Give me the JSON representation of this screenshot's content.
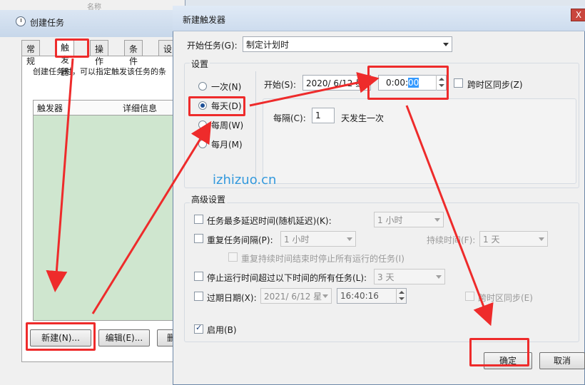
{
  "background_window": {
    "title": "创建任务",
    "top_text": "名称",
    "tabs": [
      "常规",
      "触发器",
      "操作",
      "条件",
      "设"
    ],
    "active_tab": "触发器",
    "description": "创建任务时，可以指定触发该任务的条",
    "columns": [
      "触发器",
      "详细信息"
    ],
    "buttons": {
      "new": "新建(N)...",
      "edit": "编辑(E)...",
      "delete": "删"
    }
  },
  "dialog": {
    "title": "新建触发器",
    "close_label": "X",
    "begin_task_label": "开始任务(G):",
    "begin_task_value": "制定计划时",
    "settings_label": "设置",
    "frequency": [
      "一次(N)",
      "每天(D)",
      "每周(W)",
      "每月(M)"
    ],
    "selected_frequency": "每天(D)",
    "start_label": "开始(S):",
    "start_date": "2020/ 6/12 星",
    "start_time_prefix": "0:00:",
    "start_time_selected": "00",
    "sync_tz": "跨时区同步(Z)",
    "interval_label": "每隔(C):",
    "interval_value": "1",
    "interval_suffix": "天发生一次",
    "advanced_label": "高级设置",
    "delay_label": "任务最多延迟时间(随机延迟)(K):",
    "delay_value": "1 小时",
    "repeat_label": "重复任务间隔(P):",
    "repeat_value": "1 小时",
    "duration_label": "持续时间(F):",
    "duration_value": "1 天",
    "stop_all_label": "重复持续时间结束时停止所有运行的任务(I)",
    "stop_over_label": "停止运行时间超过以下时间的所有任务(L):",
    "stop_over_value": "3 天",
    "expire_label": "过期日期(X):",
    "expire_date": "2021/ 6/12 星",
    "expire_time": "16:40:16",
    "expire_sync_tz": "跨时区同步(E)",
    "enabled_label": "启用(B)",
    "ok": "确定",
    "cancel": "取消"
  },
  "watermark": "izhizuo.cn",
  "colors": {
    "annotation": "#ee2b2b",
    "list_bg": "#cfe6cf",
    "selection": "#3399ff"
  }
}
